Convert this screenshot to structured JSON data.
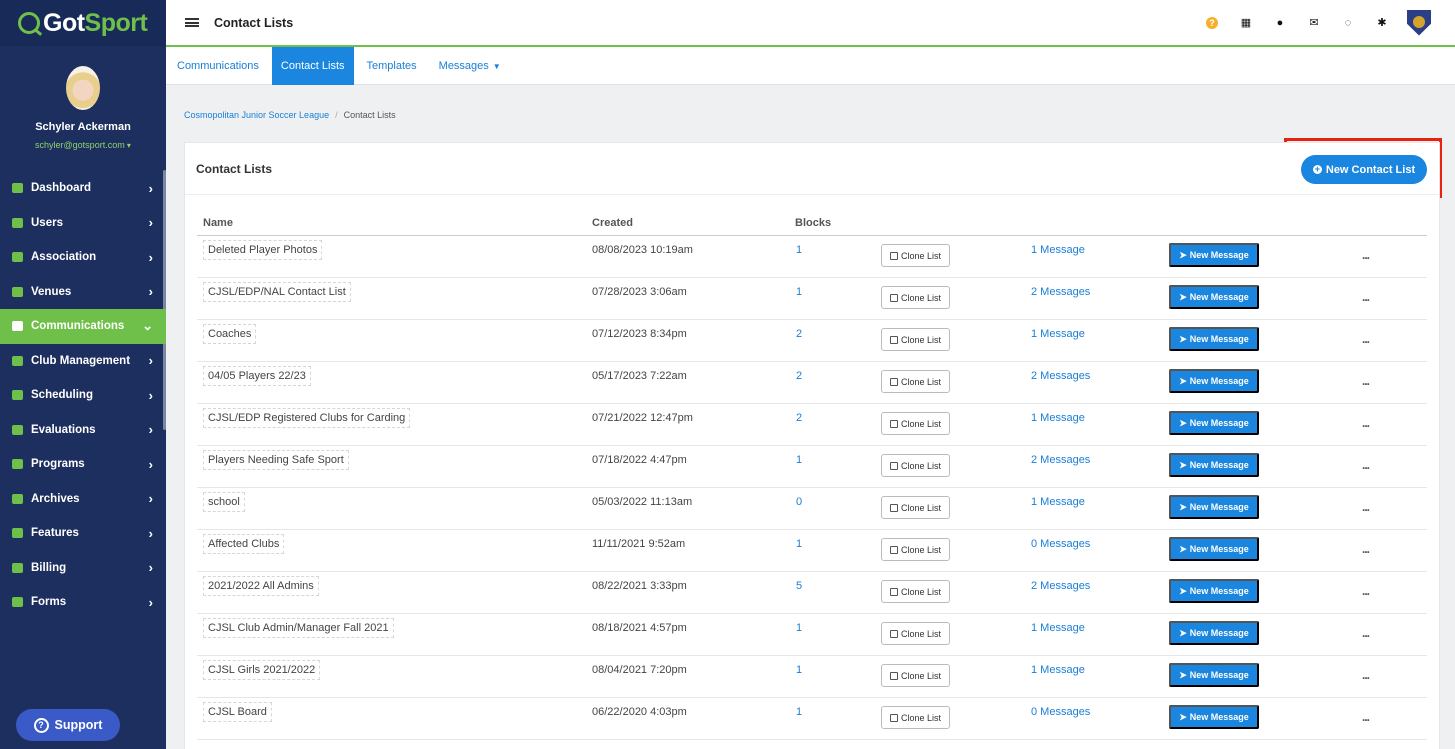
{
  "app": {
    "logo_part1": "Got",
    "logo_part2": "Sport",
    "page_title": "Contact Lists"
  },
  "user": {
    "name": "Schyler Ackerman",
    "email": "schyler@gotsport.com"
  },
  "sidebar": {
    "items": [
      {
        "label": "Dashboard",
        "icon": "dashboard-icon",
        "active": false
      },
      {
        "label": "Users",
        "icon": "users-icon",
        "active": false
      },
      {
        "label": "Association",
        "icon": "sitemap-icon",
        "active": false
      },
      {
        "label": "Venues",
        "icon": "home-icon",
        "active": false
      },
      {
        "label": "Communications",
        "icon": "chat-icon",
        "active": true
      },
      {
        "label": "Club Management",
        "icon": "list-icon",
        "active": false
      },
      {
        "label": "Scheduling",
        "icon": "calendar-icon",
        "active": false
      },
      {
        "label": "Evaluations",
        "icon": "check-calendar-icon",
        "active": false
      },
      {
        "label": "Programs",
        "icon": "document-icon",
        "active": false
      },
      {
        "label": "Archives",
        "icon": "archive-icon",
        "active": false
      },
      {
        "label": "Features",
        "icon": "star-icon",
        "active": false
      },
      {
        "label": "Billing",
        "icon": "credit-card-icon",
        "active": false
      },
      {
        "label": "Forms",
        "icon": "file-icon",
        "active": false
      }
    ],
    "support_label": "Support"
  },
  "tabs": [
    {
      "label": "Communications",
      "active": false
    },
    {
      "label": "Contact Lists",
      "active": true
    },
    {
      "label": "Templates",
      "active": false
    },
    {
      "label": "Messages",
      "active": false
    }
  ],
  "breadcrumb": {
    "parent": "Cosmopolitan Junior Soccer League",
    "current": "Contact Lists"
  },
  "panel": {
    "title": "Contact Lists",
    "new_button": "New Contact List"
  },
  "table": {
    "headers": {
      "name": "Name",
      "created": "Created",
      "blocks": "Blocks"
    },
    "clone_label": "Clone List",
    "new_message_label": "New Message",
    "more_label": "...",
    "rows": [
      {
        "name": "Deleted Player Photos",
        "created": "08/08/2023 10:19am",
        "blocks": "1",
        "messages": "1 Message"
      },
      {
        "name": "CJSL/EDP/NAL Contact List",
        "created": "07/28/2023 3:06am",
        "blocks": "1",
        "messages": "2 Messages"
      },
      {
        "name": "Coaches",
        "created": "07/12/2023 8:34pm",
        "blocks": "2",
        "messages": "1 Message"
      },
      {
        "name": "04/05 Players 22/23",
        "created": "05/17/2023 7:22am",
        "blocks": "2",
        "messages": "2 Messages"
      },
      {
        "name": "CJSL/EDP Registered Clubs for Carding",
        "created": "07/21/2022 12:47pm",
        "blocks": "2",
        "messages": "1 Message"
      },
      {
        "name": "Players Needing Safe Sport",
        "created": "07/18/2022 4:47pm",
        "blocks": "1",
        "messages": "2 Messages"
      },
      {
        "name": "school",
        "created": "05/03/2022 11:13am",
        "blocks": "0",
        "messages": "1 Message"
      },
      {
        "name": "Affected Clubs",
        "created": "11/11/2021 9:52am",
        "blocks": "1",
        "messages": "0 Messages"
      },
      {
        "name": "2021/2022 All Admins",
        "created": "08/22/2021 3:33pm",
        "blocks": "5",
        "messages": "2 Messages"
      },
      {
        "name": "CJSL Club Admin/Manager Fall 2021",
        "created": "08/18/2021 4:57pm",
        "blocks": "1",
        "messages": "1 Message"
      },
      {
        "name": "CJSL Girls 2021/2022",
        "created": "08/04/2021 7:20pm",
        "blocks": "1",
        "messages": "1 Message"
      },
      {
        "name": "CJSL Board",
        "created": "06/22/2020 4:03pm",
        "blocks": "1",
        "messages": "0 Messages"
      }
    ]
  },
  "colors": {
    "sidebar_bg": "#1d2f5e",
    "brand_green": "#6fc04a",
    "link_blue": "#1a7ed6",
    "annotation_red": "#e8230d"
  }
}
